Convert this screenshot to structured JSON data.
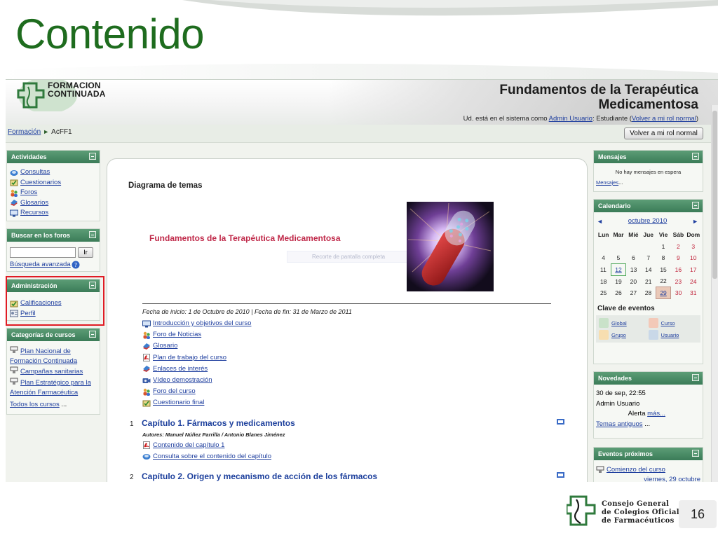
{
  "slide": {
    "title": "Contenido",
    "page_number": "16",
    "org_name_lines": [
      "Consejo General",
      "de Colegios Oficiales",
      "de Farmacéuticos"
    ]
  },
  "site": {
    "logo_lines": [
      "FORMACION",
      "CONTINUADA"
    ],
    "course_title_lines": [
      "Fundamentos de la Terapéutica",
      "Medicamentosa"
    ],
    "login": {
      "prefix": "Ud. está en el sistema como ",
      "user": "Admin Usuario",
      "middle": ": Estudiante (",
      "link": "Volver a mi rol normal",
      "suffix": ")"
    }
  },
  "navbar": {
    "breadcrumb": [
      "Formación",
      "AcFF1"
    ],
    "role_button": "Volver a mi rol normal"
  },
  "left_blocks": {
    "actividades": {
      "title": "Actividades",
      "items": [
        {
          "label": "Consultas",
          "icon": "forum-icon"
        },
        {
          "label": "Cuestionarios",
          "icon": "quiz-icon"
        },
        {
          "label": "Foros",
          "icon": "people-icon"
        },
        {
          "label": "Glosarios",
          "icon": "glossary-icon"
        },
        {
          "label": "Recursos",
          "icon": "resource-icon"
        }
      ]
    },
    "buscar": {
      "title": "Buscar en los foros",
      "button": "Ir",
      "advanced": "Búsqueda avanzada",
      "help_icon": "help-icon"
    },
    "administracion": {
      "title": "Administración",
      "items": [
        {
          "label": "Calificaciones",
          "icon": "grades-icon"
        },
        {
          "label": "Perfil",
          "icon": "profile-icon"
        }
      ]
    },
    "categorias": {
      "title": "Categorías de cursos",
      "items": [
        {
          "lines": [
            "Plan Nacional de",
            "Formación Continuada"
          ]
        },
        {
          "lines": [
            "Campañas sanitarias"
          ]
        },
        {
          "lines": [
            "Plan Estratégico para la",
            "Atención Farmacéutica"
          ]
        }
      ],
      "all_link": "Todos los cursos",
      "all_suffix": " ..."
    }
  },
  "center": {
    "heading": "Diagrama de temas",
    "section_title": "Fundamentos de la Terapéutica Medicamentosa",
    "image_overlay": "Recorte de pantalla completa",
    "dates": "Fecha de inicio: 1 de Octubre de 2010 | Fecha de fin: 31 de Marzo de 2011",
    "links": [
      {
        "label": "Introducción y objetivos del curso",
        "icon": "resource-icon"
      },
      {
        "label": "Foro de Noticias",
        "icon": "people-icon"
      },
      {
        "label": "Glosario",
        "icon": "glossary-icon"
      },
      {
        "label": "Plan de trabajo del curso",
        "icon": "pdf-icon"
      },
      {
        "label": "Enlaces de interés",
        "icon": "glossary-icon"
      },
      {
        "label": "Vídeo demostración",
        "icon": "video-icon"
      },
      {
        "label": "Foro del curso",
        "icon": "people-icon"
      },
      {
        "label": "Cuestionario final",
        "icon": "quiz-icon"
      }
    ],
    "chapters": [
      {
        "num": "1",
        "title": "Capítulo 1. Fármacos y medicamentos",
        "authors": "Autores: Manuel Núñez Parrilla / Antonio Blanes Jiménez",
        "links": [
          {
            "label": "Contenido del capítulo 1",
            "icon": "pdf-icon"
          },
          {
            "label": "Consulta sobre el contenido del capítulo",
            "icon": "forum-icon"
          }
        ]
      },
      {
        "num": "2",
        "title": "Capítulo 2. Origen y mecanismo de acción de los fármacos"
      }
    ]
  },
  "right_blocks": {
    "mensajes": {
      "title": "Mensajes",
      "empty": "No hay mensajes en espera",
      "link": "Mensajes",
      "link_suffix": "..."
    },
    "calendario": {
      "title": "Calendario",
      "month": "octubre 2010",
      "prev": "◄",
      "next": "►",
      "days": [
        "Lun",
        "Mar",
        "Mié",
        "Jue",
        "Vie",
        "Sáb",
        "Dom"
      ],
      "weeks": [
        [
          "",
          "",
          "",
          "",
          "1",
          "2",
          "3"
        ],
        [
          "4",
          "5",
          "6",
          "7",
          "8",
          "9",
          "10"
        ],
        [
          "11",
          "12",
          "13",
          "14",
          "15",
          "16",
          "17"
        ],
        [
          "18",
          "19",
          "20",
          "21",
          "22",
          "23",
          "24"
        ],
        [
          "25",
          "26",
          "27",
          "28",
          "29",
          "30",
          "31"
        ]
      ],
      "today": "12",
      "event_day": "29",
      "legend_title": "Clave de eventos",
      "legend": [
        {
          "label": "Global",
          "color": "#c9e2c9"
        },
        {
          "label": "Curso",
          "color": "#f3c9b8"
        },
        {
          "label": "Grupo",
          "color": "#f7deb0"
        },
        {
          "label": "Usuario",
          "color": "#c9d8e8"
        }
      ]
    },
    "novedades": {
      "title": "Novedades",
      "date": "30 de sep, 22:55",
      "author": "Admin Usuario",
      "text": "Alerta ",
      "more": "más...",
      "old": "Temas antiguos",
      "old_suffix": " ..."
    },
    "eventos": {
      "title": "Eventos próximos",
      "item": "Comienzo del curso",
      "date": "viernes, 29 octubre"
    }
  },
  "colors": {
    "title_green": "#1e6c1e",
    "block_header": "#3b7c58",
    "link_blue": "#1f3f9f",
    "section_red": "#c02a4a",
    "highlight_red": "#e01b24"
  }
}
